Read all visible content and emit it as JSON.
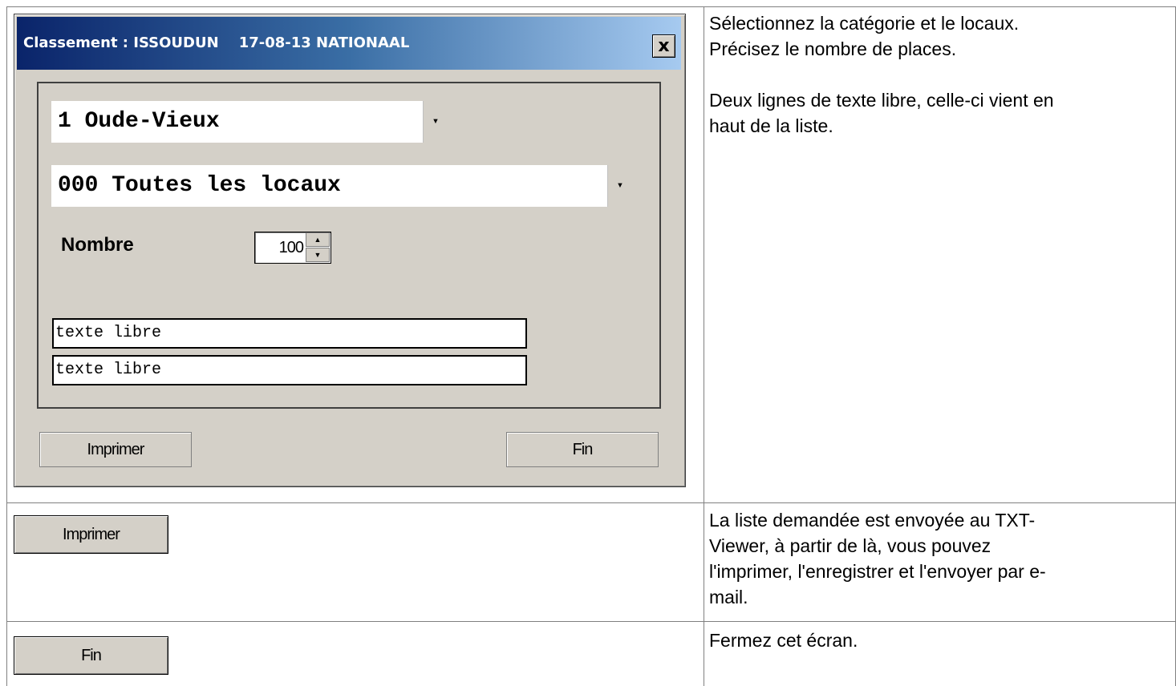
{
  "dialog": {
    "title": "Classement : ISSOUDUN    17-08-13 NATIONAAL",
    "close_label": "x",
    "category_select": "1 Oude-Vieux",
    "location_select": "000 Toutes les locaux",
    "nombre_label": "Nombre",
    "nombre_value": "100",
    "free_text_1": "texte libre",
    "free_text_2": "texte libre",
    "print_button": "Imprimer",
    "end_button": "Fin"
  },
  "rows": [
    {
      "description_lines": [
        "Sélectionnez la catégorie et le locaux.",
        "Précisez le nombre de places.",
        "",
        "Deux lignes de texte libre, celle-ci vient en",
        "haut de la liste."
      ]
    },
    {
      "button_label": "Imprimer",
      "description_lines": [
        "La liste demandée est envoyée au TXT-",
        "Viewer, à partir de là, vous pouvez",
        "l'imprimer, l'enregistrer et l'envoyer par e-",
        "mail."
      ]
    },
    {
      "button_label": "Fin",
      "description_lines": [
        "Fermez cet écran."
      ]
    }
  ],
  "colors": {
    "dialog_bg": "#d4d0c8",
    "titlebar_start": "#0a246a",
    "titlebar_end": "#a6caf0"
  }
}
